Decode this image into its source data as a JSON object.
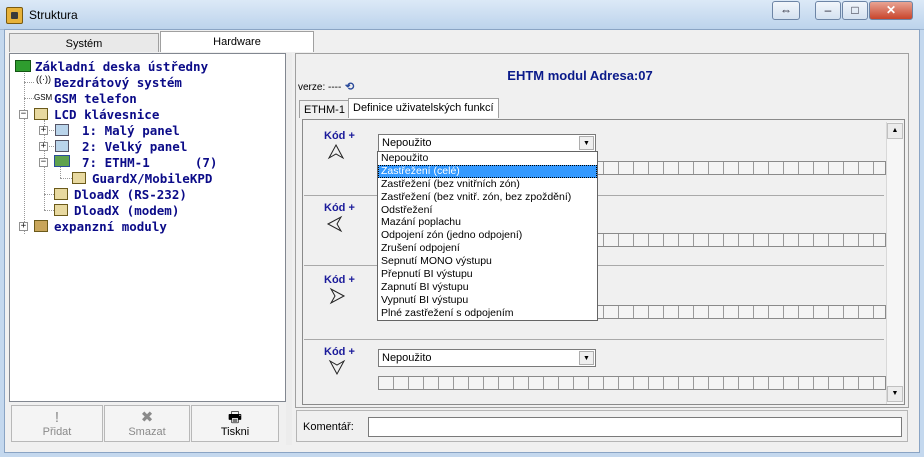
{
  "window": {
    "title": "Struktura",
    "buttons": [
      "⇔",
      "–",
      "□",
      "✕"
    ]
  },
  "left_tabs": [
    "Systém",
    "Hardware"
  ],
  "tree": [
    {
      "label": "Základní deska ústředny",
      "icon": "board-icon"
    },
    {
      "label": "Bezdrátový systém",
      "icon": "wireless-icon"
    },
    {
      "label": "GSM telefon",
      "icon": "gsm-icon"
    },
    {
      "label": "LCD klávesnice",
      "icon": "keypad-icon"
    },
    {
      "label": "1: Malý panel",
      "icon": "panel-icon"
    },
    {
      "label": "2: Velký panel",
      "icon": "panel-icon"
    },
    {
      "label": "7: ETHM-1      (7)",
      "icon": "network-icon"
    },
    {
      "label": "GuardX/MobileKPD",
      "icon": "keypad-icon"
    },
    {
      "label": "DloadX (RS-232)",
      "icon": "keypad-icon"
    },
    {
      "label": "DloadX (modem)",
      "icon": "keypad-icon"
    },
    {
      "label": "expanzní moduly",
      "icon": "modules-icon"
    }
  ],
  "bottom_buttons": {
    "add": {
      "label": "Přidat",
      "icon": "!"
    },
    "delete": {
      "label": "Smazat",
      "icon": "✖"
    },
    "print": {
      "label": "Tiskni",
      "icon": "🖶"
    }
  },
  "right": {
    "version_label": "verze: ----",
    "header": "EHTM modul Adresa:07",
    "tabs": [
      "ETHM-1",
      "Definice uživatelských funkcí"
    ],
    "sections": [
      {
        "label": "Kód +",
        "value": "Nepoužito",
        "arrow": "up-arrow-icon"
      },
      {
        "label": "Kód +",
        "value": "",
        "arrow": "left-arrow-icon"
      },
      {
        "label": "Kód +",
        "value": "",
        "arrow": "right-arrow-icon"
      },
      {
        "label": "Kód +",
        "value": "Nepoužito",
        "arrow": "down-arrow-icon"
      }
    ],
    "dropdown_options": [
      "Nepoužito",
      "Zastřežení (celé)",
      "Zastřežení (bez vnitřních zón)",
      "Zastřežení (bez vnitř. zón, bez zpoždění)",
      "Odstřežení",
      "Mazání poplachu",
      "Odpojení zón (jedno odpojení)",
      "Zrušení odpojení",
      "Sepnutí MONO výstupu",
      "Přepnutí BI výstupu",
      "Zapnutí BI výstupu",
      "Vypnutí BI výstupu",
      "Plné zastřežení s odpojením"
    ],
    "selected_option": "Zastřežení (celé)",
    "comment_label": "Komentář:",
    "comment_value": ""
  }
}
